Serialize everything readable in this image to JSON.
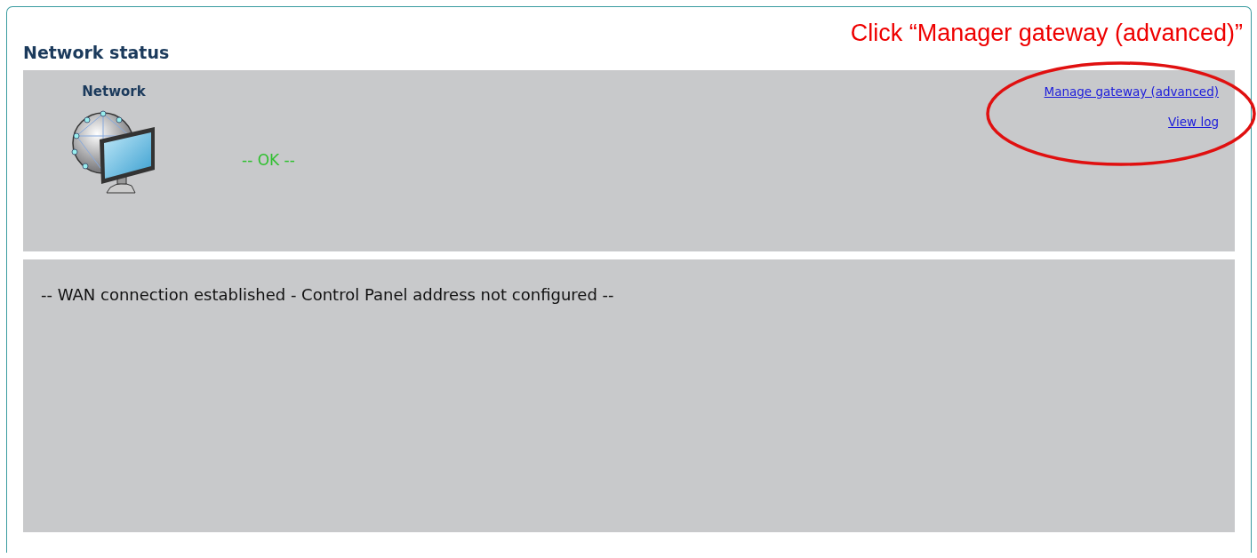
{
  "annotation": {
    "text": "Click “Manager gateway (advanced)”",
    "links_circled": true
  },
  "section_title": "Network status",
  "network_panel": {
    "label": "Network",
    "status": "-- OK --",
    "links": [
      {
        "label": "Manage gateway (advanced)"
      },
      {
        "label": "View log"
      }
    ]
  },
  "message_panel": {
    "message": "-- WAN connection established - Control Panel address not configured --"
  }
}
